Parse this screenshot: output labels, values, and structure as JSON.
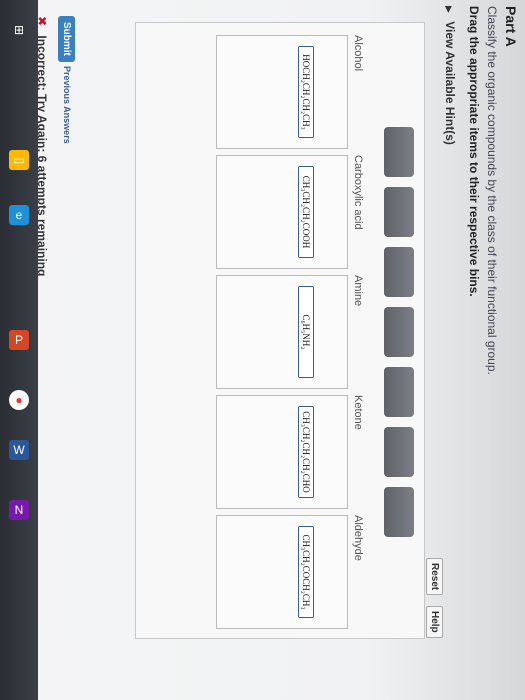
{
  "header": {
    "part": "Part A",
    "prompt": "Classify the organic compounds by the class of their functional group.",
    "instruction": "Drag the appropriate items to their respective bins.",
    "hints_label": "View Available Hint(s)"
  },
  "toolbar": {
    "reset_label": "Reset",
    "help_label": "Help"
  },
  "token_bank": {
    "count": 7
  },
  "bins": [
    {
      "label": "Alcohol",
      "item": "HOCH₂CH₂CH₂CH₃"
    },
    {
      "label": "Carboxylic acid",
      "item": "CH₃CH₂CH₂COOH"
    },
    {
      "label": "Amine",
      "item": "C₆H₅NH₂"
    },
    {
      "label": "Ketone",
      "item": "CH₃CH₂CH₂CH₂CHO"
    },
    {
      "label": "Aldehyde",
      "item": "CH₃CH₂COCH₂CH₃"
    }
  ],
  "footer": {
    "submit_label": "Submit",
    "previous_answers_label": "Previous Answers",
    "result_text": "Incorrect; Try Again; 6 attempts remaining"
  },
  "taskbar": {
    "icons": [
      "windows-icon",
      "file-explorer-icon",
      "edge-icon",
      "powerpoint-icon",
      "chrome-icon",
      "word-icon",
      "onenote-icon"
    ]
  }
}
